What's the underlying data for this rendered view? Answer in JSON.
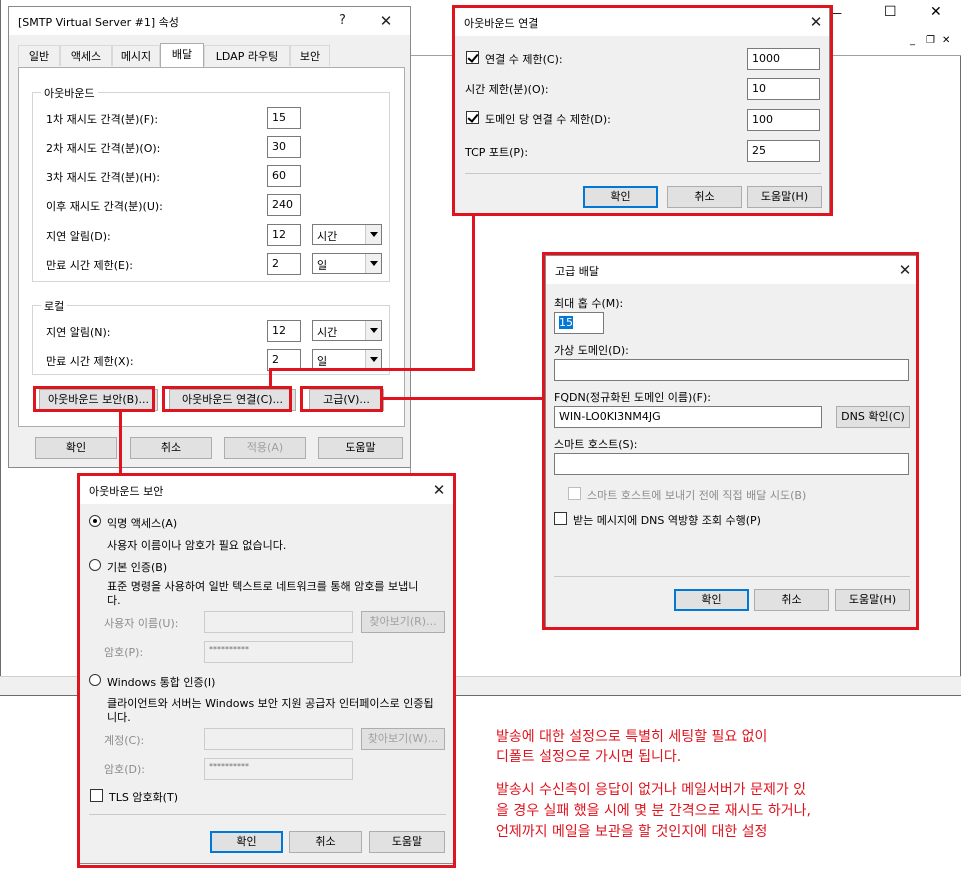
{
  "background_window": {
    "titlebar_controls": [
      "—",
      "☐",
      "✕"
    ],
    "mdi_controls": [
      "_",
      "❐",
      "✕"
    ]
  },
  "smtp_properties": {
    "title": "[SMTP Virtual Server #1] 속성",
    "help": "?",
    "close": "✕",
    "tabs": [
      "일반",
      "액세스",
      "메시지",
      "배달",
      "LDAP 라우팅",
      "보안"
    ],
    "active_tab": "배달",
    "outbound_group": "아웃바운드",
    "outbound": [
      {
        "label": "1차 재시도 간격(분)(F):",
        "value": "15"
      },
      {
        "label": "2차 재시도 간격(분)(O):",
        "value": "30"
      },
      {
        "label": "3차 재시도 간격(분)(H):",
        "value": "60"
      },
      {
        "label": "이후 재시도 간격(분)(U):",
        "value": "240"
      },
      {
        "label": "지연 알림(D):",
        "value": "12",
        "unit": "시간"
      },
      {
        "label": "만료 시간 제한(E):",
        "value": "2",
        "unit": "일"
      }
    ],
    "local_group": "로컬",
    "local": [
      {
        "label": "지연 알림(N):",
        "value": "12",
        "unit": "시간"
      },
      {
        "label": "만료 시간 제한(X):",
        "value": "2",
        "unit": "일"
      }
    ],
    "btn_outbound_security": "아웃바운드 보안(B)...",
    "btn_outbound_connection": "아웃바운드 연결(C)...",
    "btn_advanced": "고급(V)...",
    "btn_ok": "확인",
    "btn_cancel": "취소",
    "btn_apply": "적용(A)",
    "btn_help": "도움말"
  },
  "outbound_connection": {
    "title": "아웃바운드 연결",
    "close": "✕",
    "limit_connections_label": "연결 수 제한(C):",
    "limit_connections_value": "1000",
    "timeout_label": "시간 제한(분)(O):",
    "timeout_value": "10",
    "per_domain_label": "도메인 당 연결 수 제한(D):",
    "per_domain_value": "100",
    "tcp_port_label": "TCP 포트(P):",
    "tcp_port_value": "25",
    "btn_ok": "확인",
    "btn_cancel": "취소",
    "btn_help": "도움말(H)"
  },
  "advanced_delivery": {
    "title": "고급 배달",
    "close": "✕",
    "max_hop_label": "최대 홉 수(M):",
    "max_hop_value": "15",
    "masquerade_label": "가상 도메인(D):",
    "masquerade_value": "",
    "fqdn_label": "FQDN(정규화된 도메인 이름)(F):",
    "fqdn_value": "WIN-LO0KI3NM4JG",
    "btn_dns_check": "DNS 확인(C)",
    "smart_host_label": "스마트 호스트(S):",
    "smart_host_value": "",
    "direct_before_smart_label": "스마트 호스트에 보내기 전에 직접 배달 시도(B)",
    "reverse_dns_label": "받는 메시지에 DNS 역방향 조회 수행(P)",
    "btn_ok": "확인",
    "btn_cancel": "취소",
    "btn_help": "도움말(H)"
  },
  "outbound_security": {
    "title": "아웃바운드 보안",
    "close": "✕",
    "anonymous_label": "익명 액세스(A)",
    "anonymous_desc": "사용자 이름이나 암호가 필요 없습니다.",
    "basic_label": "기본 인증(B)",
    "basic_desc_1": "표준 명령을 사용하여 일반 텍스트로 네트워크를 통해 암호를 보냅니",
    "basic_desc_2": "다.",
    "username_label": "사용자 이름(U):",
    "btn_browse_r": "찾아보기(R)...",
    "password_label": "암호(P):",
    "password_value": "**********",
    "windows_label": "Windows 통합 인증(I)",
    "windows_desc_1": "클라이언트와 서버는 Windows 보안 지원 공급자 인터페이스로 인증됩",
    "windows_desc_2": "니다.",
    "account_label": "계정(C):",
    "btn_browse_w": "찾아보기(W)...",
    "password2_label": "암호(D):",
    "password2_value": "**********",
    "tls_label": "TLS 암호화(T)",
    "btn_ok": "확인",
    "btn_cancel": "취소",
    "btn_help": "도움말"
  },
  "annotation": {
    "line1": "발송에 대한 설정으로 특별히 세팅할 필요 없이",
    "line2": "디폴트 설정으로 가시면 됩니다.",
    "line3": "발송시 수신측이 응답이 없거나 메일서버가 문제가 있",
    "line4": "을 경우 실패 했을 시에 몇 분 간격으로 재시도 하거나,",
    "line5": "언제까지 메일을 보관을 할 것인지에 대한 설정"
  },
  "colors": {
    "highlight": "#e0141e",
    "dialog_bg": "#f0f0f0",
    "accent": "#0078d7"
  }
}
